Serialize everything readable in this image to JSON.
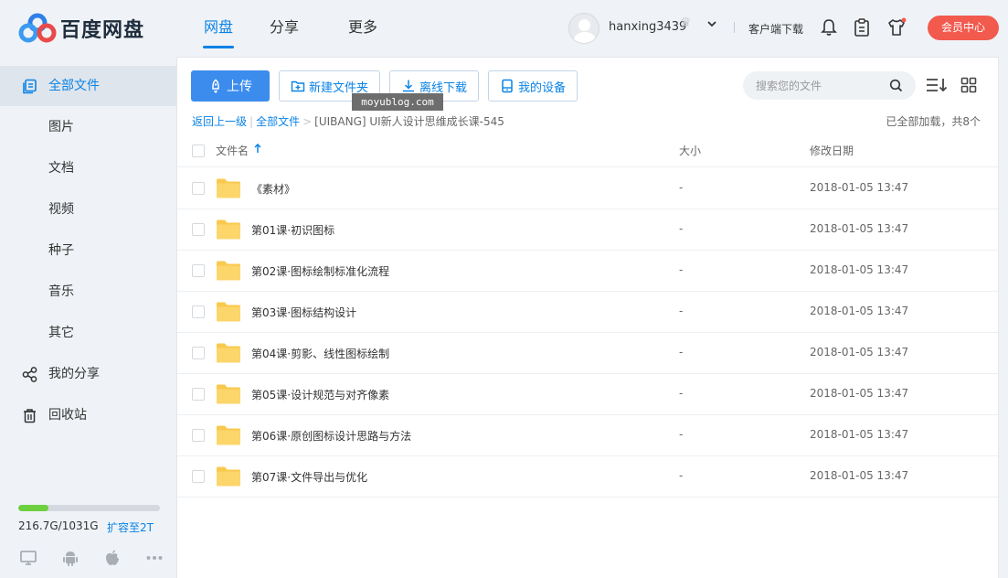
{
  "app": {
    "name": "百度网盘"
  },
  "nav": [
    "网盘",
    "分享",
    "更多"
  ],
  "user": {
    "name": "hanxing3439"
  },
  "header": {
    "client_download": "客户端下载",
    "vip_button": "会员中心"
  },
  "sidebar": {
    "items": [
      "全部文件",
      "图片",
      "文档",
      "视频",
      "种子",
      "音乐",
      "其它",
      "我的分享",
      "回收站"
    ],
    "quota_text": "216.7G/1031G",
    "quota_used_fraction": 0.21,
    "expand_link": "扩容至2T"
  },
  "toolbar": {
    "upload": "上传",
    "new_folder": "新建文件夹",
    "offline_download": "离线下载",
    "my_devices": "我的设备"
  },
  "search": {
    "placeholder": "搜索您的文件"
  },
  "watermark": "moyublog.com",
  "breadcrumb": {
    "back": "返回上一级",
    "all_files": "全部文件",
    "current": "[UIBANG] UI新人设计思维成长课-545"
  },
  "status": "已全部加载，共8个",
  "table": {
    "headers": {
      "name": "文件名",
      "size": "大小",
      "date": "修改日期"
    },
    "rows": [
      {
        "name": "《素材》",
        "size": "-",
        "date": "2018-01-05 13:47"
      },
      {
        "name": "第01课·初识图标",
        "size": "-",
        "date": "2018-01-05 13:47"
      },
      {
        "name": "第02课·图标绘制标准化流程",
        "size": "-",
        "date": "2018-01-05 13:47"
      },
      {
        "name": "第03课·图标结构设计",
        "size": "-",
        "date": "2018-01-05 13:47"
      },
      {
        "name": "第04课·剪影、线性图标绘制",
        "size": "-",
        "date": "2018-01-05 13:47"
      },
      {
        "name": "第05课·设计规范与对齐像素",
        "size": "-",
        "date": "2018-01-05 13:47"
      },
      {
        "name": "第06课·原创图标设计思路与方法",
        "size": "-",
        "date": "2018-01-05 13:47"
      },
      {
        "name": "第07课·文件导出与优化",
        "size": "-",
        "date": "2018-01-05 13:47"
      }
    ]
  },
  "colors": {
    "accent": "#0a83e6",
    "primary_button": "#3b8ced",
    "vip": "#f25a4e",
    "quota_fill": "#6dd03f",
    "folder": "#fcd56b"
  }
}
